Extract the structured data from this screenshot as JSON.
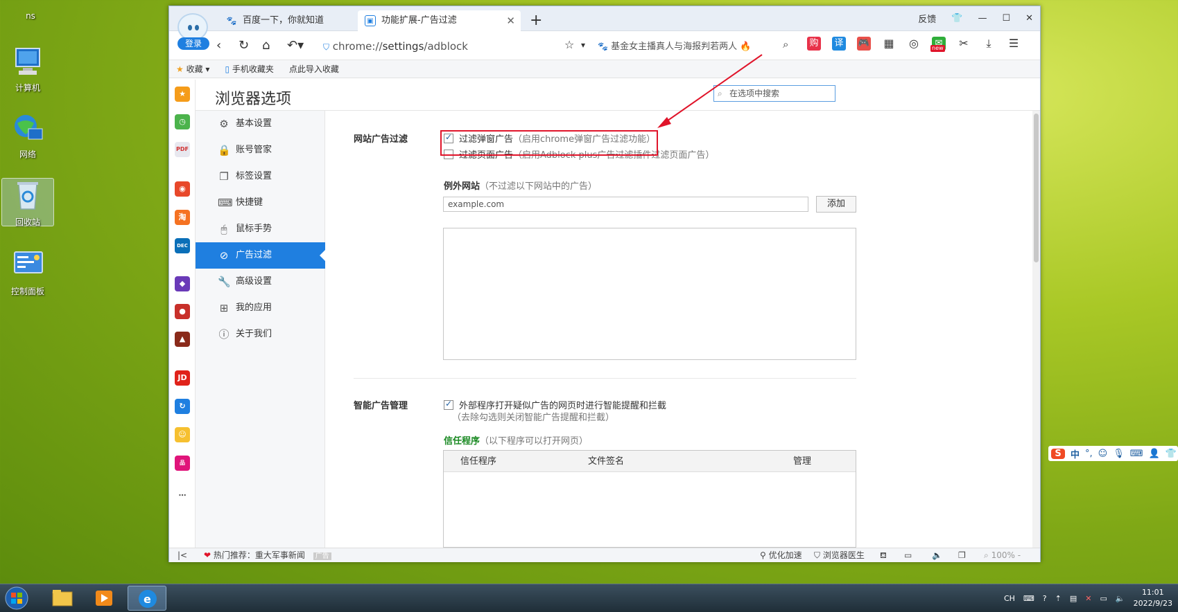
{
  "desktop": {
    "icons": [
      {
        "label": "ns"
      },
      {
        "label": "计算机"
      },
      {
        "label": "网络"
      },
      {
        "label": "回收站"
      },
      {
        "label": "控制面板"
      }
    ]
  },
  "browser": {
    "avatar": {
      "login_label": "登录"
    },
    "tabs": [
      {
        "title": "百度一下，你就知道"
      },
      {
        "title": "功能扩展-广告过滤"
      }
    ],
    "window_controls": {
      "feedback": "反馈"
    },
    "address": {
      "scheme": "chrome://",
      "host": "settings",
      "path": "/adblock"
    },
    "search_suggestion": "基金女主播真人与海报判若两人",
    "toolbar_badges": {
      "shop": "购",
      "translate": "译",
      "new": "new"
    },
    "bookmarks": [
      {
        "label": "收藏"
      },
      {
        "label": "手机收藏夹"
      },
      {
        "label": "点此导入收藏"
      }
    ]
  },
  "settings": {
    "page_title": "浏览器选项",
    "search_placeholder": "在选项中搜索",
    "nav": [
      {
        "label": "基本设置",
        "icon": "gear-icon"
      },
      {
        "label": "账号管家",
        "icon": "lock-icon"
      },
      {
        "label": "标签设置",
        "icon": "tabs-icon"
      },
      {
        "label": "快捷键",
        "icon": "keyboard-icon"
      },
      {
        "label": "鼠标手势",
        "icon": "mouse-icon"
      },
      {
        "label": "广告过滤",
        "icon": "block-icon"
      },
      {
        "label": "高级设置",
        "icon": "wrench-icon"
      },
      {
        "label": "我的应用",
        "icon": "apps-icon"
      },
      {
        "label": "关于我们",
        "icon": "info-icon"
      }
    ],
    "adfilter": {
      "section_label": "网站广告过滤",
      "popup": {
        "label": "过滤弹窗广告",
        "hint": "（启用chrome弹窗广告过滤功能）",
        "checked": true
      },
      "page": {
        "label": "过滤页面广告",
        "hint": "（启用Adblock plus广告过滤插件过滤页面广告）",
        "checked": false
      },
      "exceptions_title": "例外网站",
      "exceptions_hint": "（不过滤以下网站中的广告）",
      "exception_placeholder": "example.com",
      "add_button": "添加"
    },
    "smart": {
      "section_label": "智能广告管理",
      "option": {
        "label": "外部程序打开疑似广告的网页时进行智能提醒和拦截",
        "hint": "（去除勾选则关闭智能广告提醒和拦截）",
        "checked": true
      },
      "trusted_title": "信任程序",
      "trusted_hint": "（以下程序可以打开网页）",
      "table_headers": [
        "信任程序",
        "文件签名",
        "管理"
      ]
    }
  },
  "statusbar": {
    "hot_label": "热门推荐：",
    "hot_text": "重大军事新闻",
    "ad_tag": "广告",
    "optimize": "优化加速",
    "doctor": "浏览器医生",
    "zoom": "100%"
  },
  "ime": {
    "mode": "中"
  },
  "tray": {
    "lang": "CH",
    "time": "11:01",
    "date": "2022/9/23"
  },
  "colors": {
    "accent": "#1f7fe0",
    "highlight": "#e0142a",
    "green": "#1b8a24"
  }
}
